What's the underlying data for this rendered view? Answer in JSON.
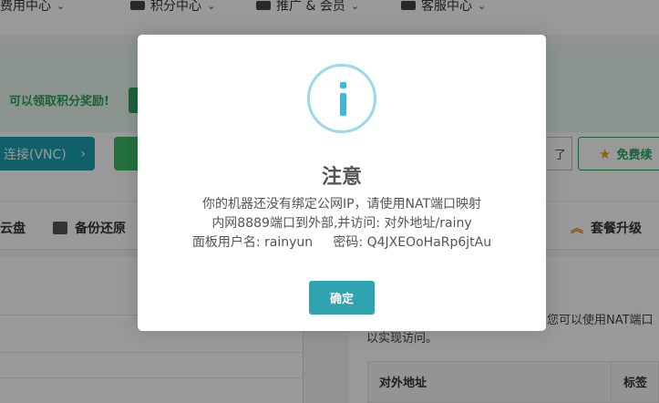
{
  "nav": {
    "items": [
      {
        "label": "费用中心",
        "icon": "wallet-icon"
      },
      {
        "label": "积分中心",
        "icon": "gift-icon"
      },
      {
        "label": "推广 & 会员",
        "icon": "users-icon"
      },
      {
        "label": "客服中心",
        "icon": "headset-icon"
      }
    ]
  },
  "banner": {
    "text": "可以领取积分奖励!"
  },
  "hero": {
    "vnc_label": "连接(VNC)",
    "vnc_arrow": "›",
    "outline_label": "了",
    "free_label": "免费续"
  },
  "toolbar": {
    "items": [
      {
        "label": "云盘"
      },
      {
        "label": "备份还原",
        "icon": "database-icon"
      },
      {
        "label": "套餐升级",
        "icon": "double-up-icon"
      }
    ]
  },
  "nat_panel": {
    "line1": "您可以使用NAT端口",
    "line2": "以实现访问。",
    "col_address": "对外地址",
    "col_tag": "标签"
  },
  "modal": {
    "title": "注意",
    "line1": "你的机器还没有绑定公网IP，请使用NAT端口映射",
    "line2": "内网8889端口到外部,并访问: 对外地址/rainy",
    "line3": "面板用户名: rainyun     密码: Q4JXEOoHaRp6jtAu",
    "confirm_label": "确定",
    "accent": "#2fa3b0",
    "icon_color": "#36b9e4"
  }
}
